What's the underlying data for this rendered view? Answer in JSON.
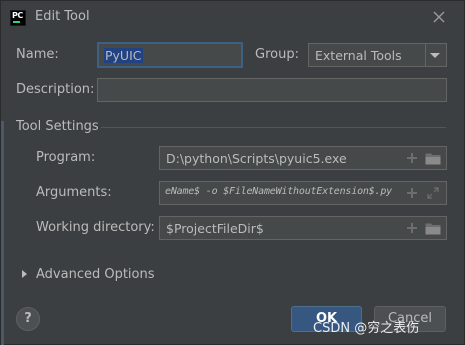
{
  "dialog": {
    "title": "Edit Tool",
    "app_icon_text": "PC"
  },
  "name_row": {
    "label": "Name:",
    "value": "PyUIC",
    "group_label": "Group:",
    "group_value": "External Tools"
  },
  "description_row": {
    "label": "Description:",
    "value": ""
  },
  "tool_settings": {
    "title": "Tool Settings",
    "program": {
      "label": "Program:",
      "value": "D:\\python\\Scripts\\pyuic5.exe"
    },
    "arguments": {
      "label": "Arguments:",
      "value": "eName$ -o $FileNameWithoutExtension$.py"
    },
    "working_directory": {
      "label": "Working directory:",
      "value": "$ProjectFileDir$"
    }
  },
  "advanced_options": {
    "label": "Advanced Options"
  },
  "buttons": {
    "help": "?",
    "ok": "OK",
    "cancel": "Cancel"
  },
  "watermark": "CSDN @穷之表伤",
  "colors": {
    "background": "#3c3f41",
    "field": "#45494a",
    "focus_border": "#3d6185",
    "selection": "#214283",
    "ok_button": "#365880",
    "text": "#bbbbbb"
  }
}
